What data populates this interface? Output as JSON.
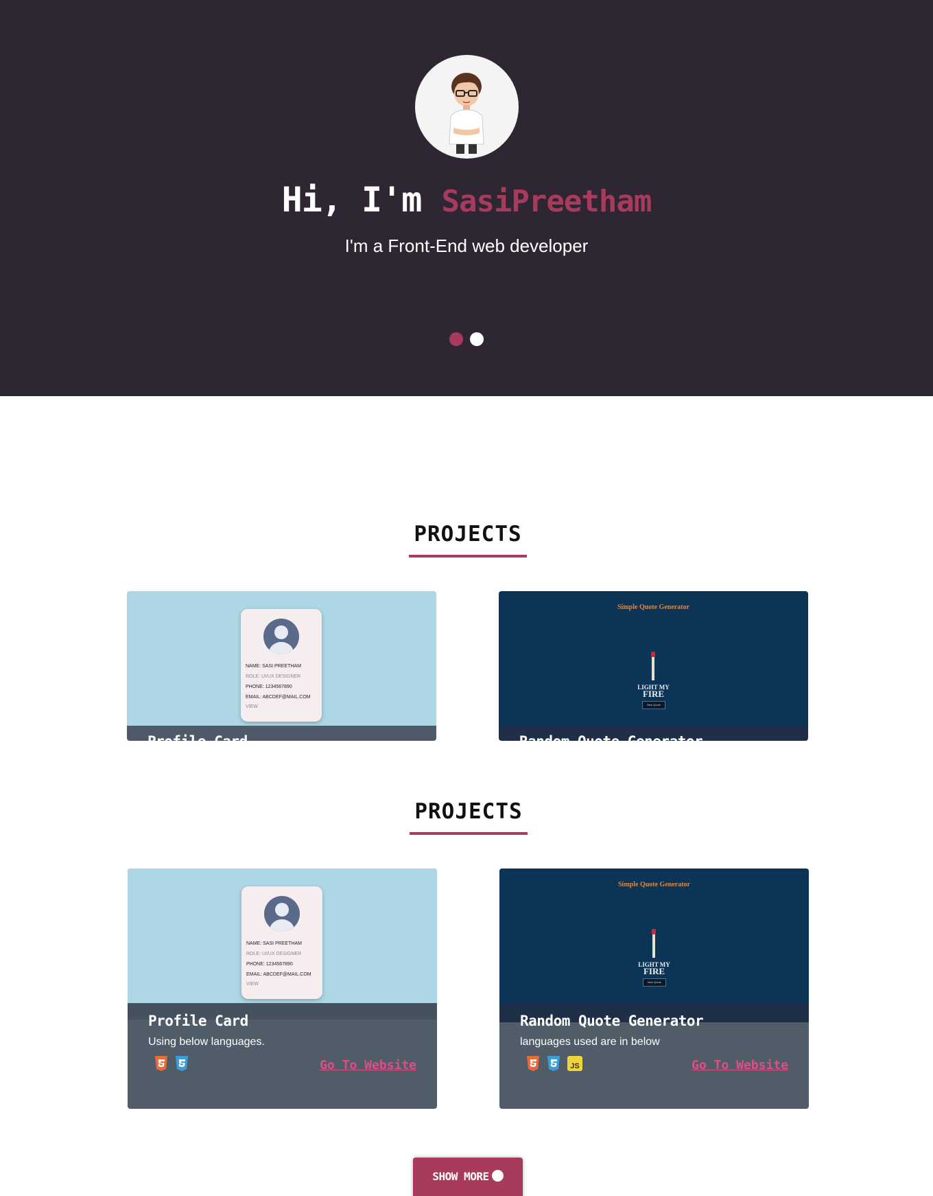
{
  "hero": {
    "greeting": "Hi, I'm",
    "name": "SasiPreetham",
    "subtitle": "I'm a Front-End web developer",
    "avatar_icon": "cartoon-avatar",
    "colors": {
      "background": "#2e2733",
      "accent": "#a83a5c"
    }
  },
  "sections": [
    {
      "title": "PROJECTS",
      "cards": [
        {
          "title": "Profile Card"
        },
        {
          "title": "Random Quote Generator"
        }
      ]
    },
    {
      "title": "PROJECTS",
      "cards": [
        {
          "title": "Profile Card",
          "description": "Using below languages.",
          "languages": [
            "html5-icon",
            "css3-icon"
          ],
          "link_label": "Go To Website"
        },
        {
          "title": "Random Quote Generator",
          "description": "languages used are in below",
          "languages": [
            "html5-icon",
            "css3-icon",
            "js-icon"
          ],
          "link_label": "Go To Website"
        }
      ]
    }
  ],
  "thumbs": {
    "profile": {
      "name": "NAME: SASI PREETHAM",
      "role": "ROLE: UI/UX DESIGNER",
      "phone": "PHONE: 1234567890",
      "email": "EMAIL: ABCDEF@MAIL.COM",
      "view": "VIEW"
    },
    "quote": {
      "title": "Simple Quote Generator",
      "fire_line1": "LIGHT MY",
      "fire_line2": "FIRE",
      "button": "New Quote"
    }
  },
  "show_more": {
    "label": "SHOW MORE"
  }
}
